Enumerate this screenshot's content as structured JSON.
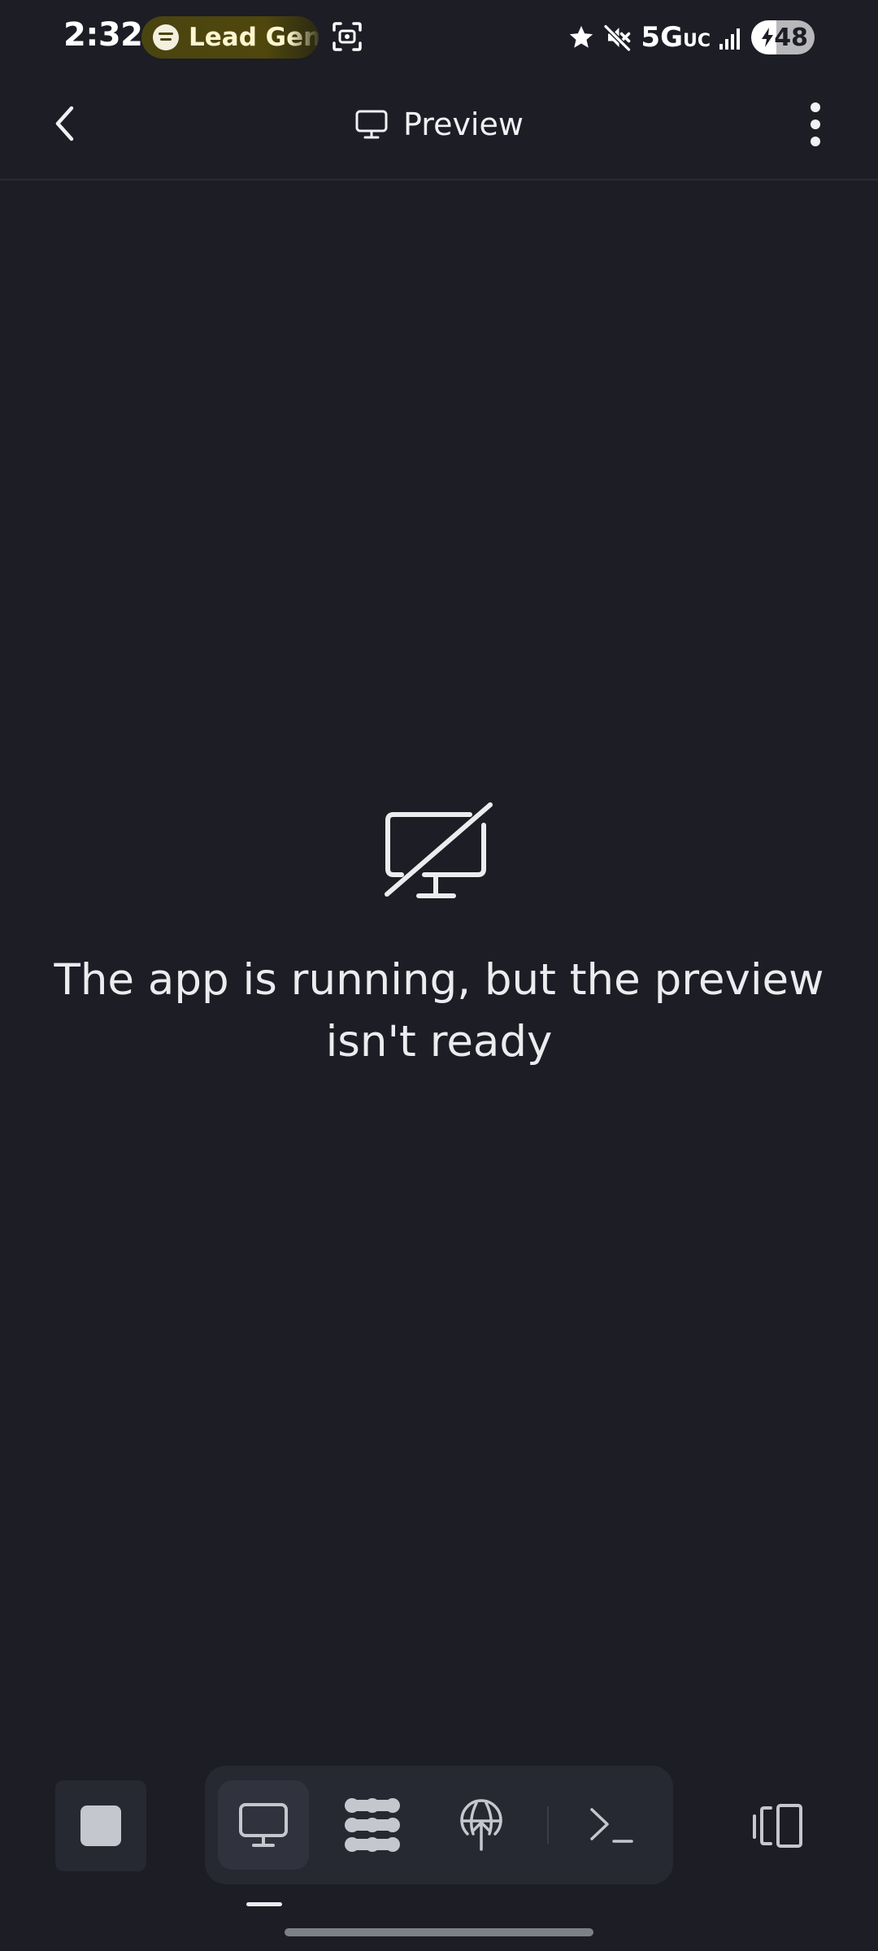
{
  "status_bar": {
    "time": "2:32",
    "media_pill_label": "Lead Gen",
    "network_main": "5G",
    "network_sub": "UC",
    "battery_level": "48",
    "icons": [
      "spotify-icon",
      "screen-record-icon",
      "star-icon",
      "mute-icon",
      "signal-icon",
      "battery-charging-icon"
    ]
  },
  "header": {
    "title": "Preview",
    "icons": [
      "back-chevron-icon",
      "monitor-icon",
      "more-vertical-icon"
    ]
  },
  "empty_state": {
    "icon": "monitor-off-icon",
    "message": "The app is running, but the preview isn't ready"
  },
  "toolbar": {
    "stop_icon": "stop-icon",
    "tools": [
      {
        "name": "preview",
        "icon": "monitor-icon",
        "active": true
      },
      {
        "name": "workflow",
        "icon": "nodes-icon",
        "active": false
      },
      {
        "name": "deploy",
        "icon": "globe-upload-icon",
        "active": false
      },
      {
        "name": "console",
        "icon": "terminal-icon",
        "active": false
      }
    ],
    "layout_icon": "layout-toggle-icon"
  },
  "colors": {
    "background": "#1c1d25",
    "surface": "#262832",
    "surface_active": "#30323d",
    "text": "#f1f1f3",
    "icon": "#c5c7ce",
    "pill_bg": "#4f470c"
  }
}
